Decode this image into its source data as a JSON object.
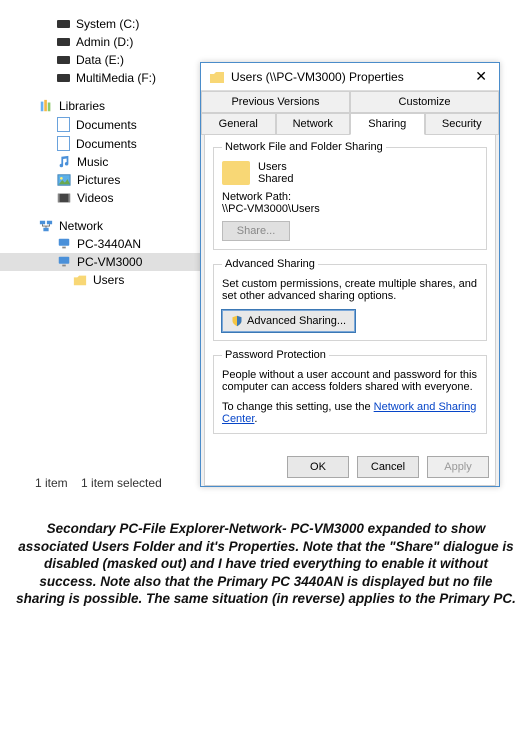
{
  "explorer": {
    "drives": [
      {
        "label": "System (C:)"
      },
      {
        "label": "Admin (D:)"
      },
      {
        "label": "Data (E:)"
      },
      {
        "label": "MultiMedia (F:)"
      }
    ],
    "libraries_label": "Libraries",
    "libraries": [
      {
        "label": "Documents"
      },
      {
        "label": "Documents"
      },
      {
        "label": "Music"
      },
      {
        "label": "Pictures"
      },
      {
        "label": "Videos"
      }
    ],
    "network_label": "Network",
    "network": [
      {
        "label": "PC-3440AN",
        "selected": false
      },
      {
        "label": "PC-VM3000",
        "selected": true
      }
    ],
    "network_child": "Users"
  },
  "status": {
    "items": "1 item",
    "selected": "1 item selected"
  },
  "props": {
    "title": "Users (\\\\PC-VM3000) Properties",
    "tabs_row1": [
      "Previous Versions",
      "Customize"
    ],
    "tabs_row2": [
      "General",
      "Network",
      "Sharing",
      "Security"
    ],
    "active_tab": "Sharing",
    "nfs": {
      "legend": "Network File and Folder Sharing",
      "name": "Users",
      "state": "Shared",
      "path_label": "Network Path:",
      "path_value": "\\\\PC-VM3000\\Users",
      "share_btn": "Share..."
    },
    "adv": {
      "legend": "Advanced Sharing",
      "text": "Set custom permissions, create multiple shares, and set other advanced sharing options.",
      "btn": "Advanced Sharing..."
    },
    "pwd": {
      "legend": "Password Protection",
      "text1": "People without a user account and password for this computer can access folders shared with everyone.",
      "text2": "To change this setting, use the ",
      "link": "Network and Sharing Center",
      "period": "."
    },
    "buttons": {
      "ok": "OK",
      "cancel": "Cancel",
      "apply": "Apply"
    }
  },
  "caption": "Secondary PC-File Explorer-Network- PC-VM3000  expanded to show associated Users Folder and it's Properties. Note that the \"Share\" dialogue is disabled (masked out) and I have tried everything to enable it without success. Note also that  the Primary PC 3440AN is displayed but no file sharing is possible. The same situation (in reverse) applies to the Primary PC."
}
